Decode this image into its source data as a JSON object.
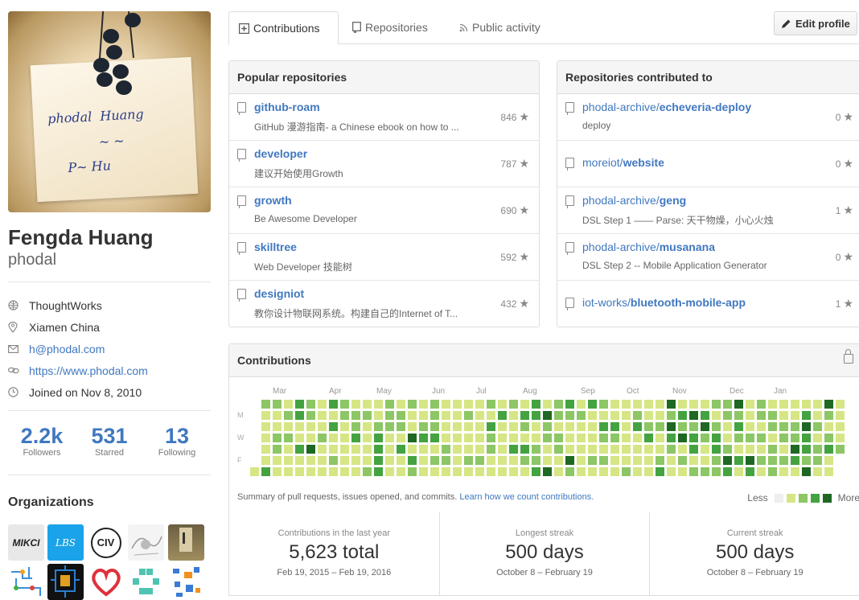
{
  "profile": {
    "full_name": "Fengda Huang",
    "username": "phodal",
    "company": "ThoughtWorks",
    "location": "Xiamen China",
    "email": "h@phodal.com",
    "website": "https://www.phodal.com",
    "joined": "Joined on Nov 8, 2010",
    "stats": [
      {
        "value": "2.2k",
        "label": "Followers"
      },
      {
        "value": "531",
        "label": "Starred"
      },
      {
        "value": "13",
        "label": "Following"
      }
    ],
    "organizations_title": "Organizations",
    "organizations": [
      "MIKCI",
      "LBS",
      "CIV"
    ]
  },
  "tabs": [
    {
      "label": "Contributions",
      "icon": "contributions-icon",
      "active": true
    },
    {
      "label": "Repositories",
      "icon": "repo-icon",
      "active": false
    },
    {
      "label": "Public activity",
      "icon": "rss-icon",
      "active": false
    }
  ],
  "edit_profile_label": "Edit profile",
  "popular": {
    "title": "Popular repositories",
    "repos": [
      {
        "name": "github-roam",
        "desc": "GitHub 漫游指南- a Chinese ebook on how to ...",
        "stars": "846"
      },
      {
        "name": "developer",
        "desc": "建议开始使用Growth",
        "stars": "787"
      },
      {
        "name": "growth",
        "desc": "Be Awesome Developer",
        "stars": "690"
      },
      {
        "name": "skilltree",
        "desc": "Web Developer 技能树",
        "stars": "592"
      },
      {
        "name": "designiot",
        "desc": "教你设计物联网系统。构建自己的Internet of T...",
        "stars": "432"
      }
    ]
  },
  "contributed": {
    "title": "Repositories contributed to",
    "repos": [
      {
        "owner": "phodal-archive/",
        "name": "echeveria-deploy",
        "desc": "deploy",
        "stars": "0"
      },
      {
        "owner": "moreiot/",
        "name": "website",
        "desc": "",
        "stars": "0"
      },
      {
        "owner": "phodal-archive/",
        "name": "geng",
        "desc": "DSL Step 1 —— Parse: 天干物燥，小心火烛",
        "stars": "1"
      },
      {
        "owner": "phodal-archive/",
        "name": "musanana",
        "desc": "DSL Step 2 -- Mobile Application Generator",
        "stars": "0"
      },
      {
        "owner": "iot-works/",
        "name": "bluetooth-mobile-app",
        "desc": "",
        "stars": "1"
      }
    ]
  },
  "contributions": {
    "title": "Contributions",
    "months": [
      "Mar",
      "Apr",
      "May",
      "Jun",
      "Jul",
      "Aug",
      "Sep",
      "Oct",
      "Nov",
      "Dec",
      "Jan"
    ],
    "day_labels": [
      "M",
      "W",
      "F"
    ],
    "summary_text": "Summary of pull requests, issues opened, and commits.",
    "summary_link": "Learn how we count contributions.",
    "legend_less": "Less",
    "legend_more": "More",
    "colors": [
      "#eeeeee",
      "#d6e685",
      "#8cc665",
      "#44a340",
      "#1e6823"
    ]
  },
  "contribution_stats": [
    {
      "title": "Contributions in the last year",
      "value": "5,623 total",
      "dates": "Feb 19, 2015 – Feb 19, 2016"
    },
    {
      "title": "Longest streak",
      "value": "500 days",
      "dates": "October 8 – February 19"
    },
    {
      "title": "Current streak",
      "value": "500 days",
      "dates": "October 8 – February 19"
    }
  ]
}
